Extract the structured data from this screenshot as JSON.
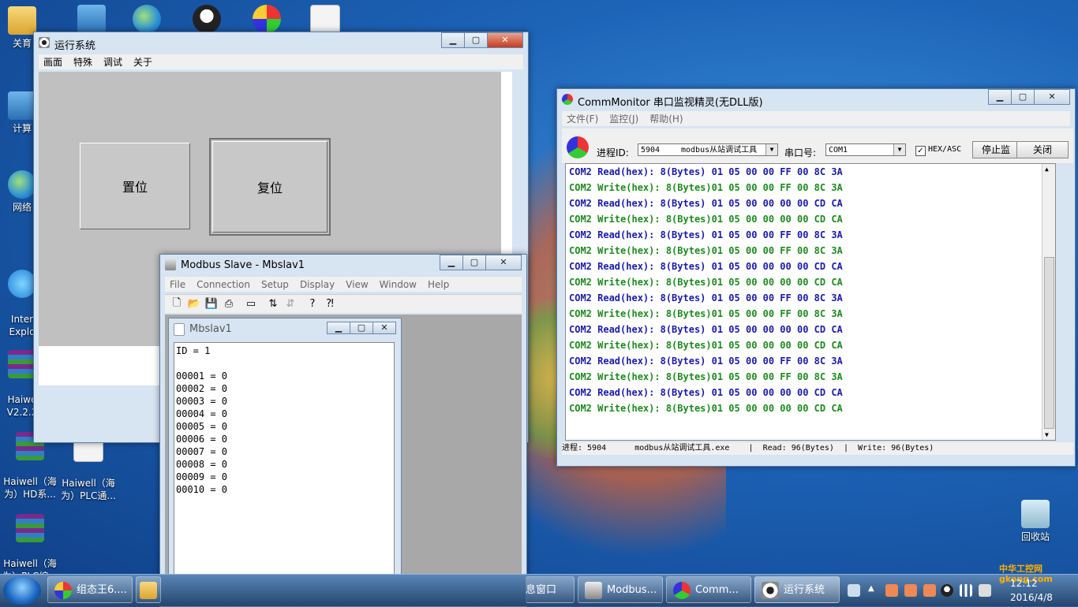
{
  "desktop": {
    "icons": [
      {
        "label": "关育"
      },
      {
        "label": "计算"
      },
      {
        "label": "网络"
      },
      {
        "label": "Inter\nExplo"
      },
      {
        "label": "Haiwe\nV2.2.2"
      },
      {
        "label": "Haiwell（海\n为）HD系..."
      },
      {
        "label": "Haiwell（海\n为）PLC通..."
      },
      {
        "label": "Haiwell（海\n为）PLC编..."
      },
      {
        "label": "回收站"
      }
    ]
  },
  "runtime_window": {
    "title": "运行系统",
    "menu": [
      "画面",
      "特殊",
      "调试",
      "关于"
    ],
    "buttons": {
      "set": "置位",
      "reset": "复位"
    }
  },
  "comm_monitor": {
    "title": "CommMonitor 串口监视精灵(无DLL版)",
    "menu": [
      "文件(F)",
      "监控(J)",
      "帮助(H)"
    ],
    "process_label": "进程ID:",
    "process_id": "5904",
    "process_name": "modbus从站调试工具",
    "port_label": "串口号:",
    "port_value": "COM1",
    "hex_asc_label": "HEX/ASC",
    "hex_asc_checked": true,
    "stop_button": "停止监",
    "close_button": "关闭",
    "log": [
      {
        "type": "read",
        "text": "COM2 Read(hex): 8(Bytes) 01 05 00 00 FF 00 8C 3A"
      },
      {
        "type": "write",
        "text": "COM2 Write(hex): 8(Bytes)01 05 00 00 FF 00 8C 3A"
      },
      {
        "type": "read",
        "text": "COM2 Read(hex): 8(Bytes) 01 05 00 00 00 00 CD CA"
      },
      {
        "type": "write",
        "text": "COM2 Write(hex): 8(Bytes)01 05 00 00 00 00 CD CA"
      },
      {
        "type": "read",
        "text": "COM2 Read(hex): 8(Bytes) 01 05 00 00 FF 00 8C 3A"
      },
      {
        "type": "write",
        "text": "COM2 Write(hex): 8(Bytes)01 05 00 00 FF 00 8C 3A"
      },
      {
        "type": "read",
        "text": "COM2 Read(hex): 8(Bytes) 01 05 00 00 00 00 CD CA"
      },
      {
        "type": "write",
        "text": "COM2 Write(hex): 8(Bytes)01 05 00 00 00 00 CD CA"
      },
      {
        "type": "read",
        "text": "COM2 Read(hex): 8(Bytes) 01 05 00 00 FF 00 8C 3A"
      },
      {
        "type": "write",
        "text": "COM2 Write(hex): 8(Bytes)01 05 00 00 FF 00 8C 3A"
      },
      {
        "type": "read",
        "text": "COM2 Read(hex): 8(Bytes) 01 05 00 00 00 00 CD CA"
      },
      {
        "type": "write",
        "text": "COM2 Write(hex): 8(Bytes)01 05 00 00 00 00 CD CA"
      },
      {
        "type": "read",
        "text": "COM2 Read(hex): 8(Bytes) 01 05 00 00 FF 00 8C 3A"
      },
      {
        "type": "write",
        "text": "COM2 Write(hex): 8(Bytes)01 05 00 00 FF 00 8C 3A"
      },
      {
        "type": "read",
        "text": "COM2 Read(hex): 8(Bytes) 01 05 00 00 00 00 CD CA"
      },
      {
        "type": "write",
        "text": "COM2 Write(hex): 8(Bytes)01 05 00 00 00 00 CD CA"
      }
    ],
    "status": "进程: 5904      modbus从站调试工具.exe    |  Read: 96(Bytes)  |  Write: 96(Bytes)"
  },
  "modbus_slave": {
    "title": "Modbus Slave - Mbslav1",
    "menu": [
      "File",
      "Connection",
      "Setup",
      "Display",
      "View",
      "Window",
      "Help"
    ],
    "toolbar_icons": [
      "new-icon",
      "open-icon",
      "save-icon",
      "print-icon",
      "window-icon",
      "connect-icon",
      "disconnect-icon",
      "help-icon",
      "context-help-icon"
    ],
    "child_title": "Mbslav1",
    "id_line": "ID = 1",
    "registers": [
      "00001 = 0",
      "00002 = 0",
      "00003 = 0",
      "00004 = 0",
      "00005 = 0",
      "00006 = 0",
      "00007 = 0",
      "00008 = 0",
      "00009 = 0",
      "00010 = 0"
    ]
  },
  "taskbar": {
    "items": [
      "组态王6....",
      "",
      "息窗口",
      "Modbus...",
      "Comm...",
      "运行系统"
    ],
    "time": "12:12",
    "date": "2016/4/8",
    "watermark": "中华工控网 gkong.com"
  }
}
